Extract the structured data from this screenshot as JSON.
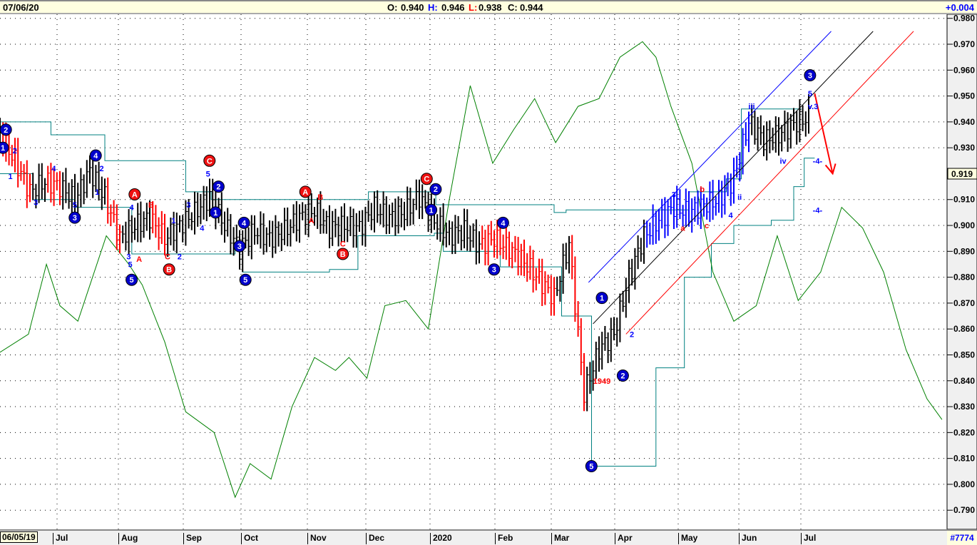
{
  "header": {
    "date": "07/06/20",
    "open_label": "O:",
    "open": "0.940",
    "high_label": "H:",
    "high": "0.946",
    "low_label": "L:",
    "low": "0.938",
    "close_label": "C:",
    "close": "0.944",
    "change": "+0.004"
  },
  "footer": {
    "start_date": "06/05/19",
    "months": [
      "Jul",
      "Aug",
      "Sep",
      "Oct",
      "Nov",
      "Dec",
      "2020",
      "Feb",
      "Mar",
      "Apr",
      "May",
      "Jun",
      "Jul"
    ],
    "record_count": "#7774"
  },
  "colors": {
    "up": "#000000",
    "down": "#ff0000",
    "blue": "#0000ff",
    "osc": "#008000",
    "band": "#008080",
    "axis_bg": "#f0f0f0"
  },
  "chart_data": {
    "type": "bar",
    "title": "",
    "ylim": [
      0.785,
      0.981
    ],
    "yticks": [
      "0.980",
      "0.970",
      "0.960",
      "0.950",
      "0.940",
      "0.930",
      "0.910",
      "0.900",
      "0.890",
      "0.880",
      "0.870",
      "0.860",
      "0.850",
      "0.840",
      "0.830",
      "0.820",
      "0.810",
      "0.800",
      "0.790"
    ],
    "last_price": "0.919",
    "x_unit": "weeks since 06/05/19",
    "weekly_closes": [
      0.935,
      0.925,
      0.913,
      0.917,
      0.915,
      0.91,
      0.921,
      0.911,
      0.895,
      0.9,
      0.903,
      0.895,
      0.9,
      0.905,
      0.911,
      0.9,
      0.891,
      0.898,
      0.895,
      0.898,
      0.903,
      0.906,
      0.899,
      0.9,
      0.899,
      0.907,
      0.903,
      0.905,
      0.911,
      0.902,
      0.896,
      0.898,
      0.892,
      0.895,
      0.891,
      0.886,
      0.879,
      0.872,
      0.893,
      0.835,
      0.852,
      0.858,
      0.88,
      0.896,
      0.902,
      0.907,
      0.905,
      0.908,
      0.91,
      0.918,
      0.94,
      0.933,
      0.935,
      0.939,
      0.942
    ],
    "bar_colors": [
      "k",
      "r",
      "r",
      "k",
      "r",
      "k",
      "k",
      "k",
      "r",
      "k",
      "k",
      "r",
      "k",
      "k",
      "k",
      "k",
      "k",
      "k",
      "k",
      "k",
      "k",
      "k",
      "k",
      "k",
      "k",
      "k",
      "k",
      "k",
      "k",
      "k",
      "k",
      "k",
      "k",
      "r",
      "r",
      "r",
      "r",
      "r",
      "k",
      "r",
      "k",
      "k",
      "k",
      "k",
      "b",
      "b",
      "b",
      "b",
      "b",
      "b",
      "b",
      "k",
      "k",
      "k",
      "k"
    ],
    "oscillator": [
      [
        0,
        0.851
      ],
      [
        1.9,
        0.858
      ],
      [
        3.1,
        0.885
      ],
      [
        4,
        0.869
      ],
      [
        5.2,
        0.863
      ],
      [
        7.1,
        0.896
      ],
      [
        8.6,
        0.885
      ],
      [
        9.5,
        0.877
      ],
      [
        11,
        0.855
      ],
      [
        12.4,
        0.828
      ],
      [
        14.3,
        0.82
      ],
      [
        15.7,
        0.795
      ],
      [
        16.7,
        0.808
      ],
      [
        18.1,
        0.802
      ],
      [
        19.5,
        0.83
      ],
      [
        21,
        0.849
      ],
      [
        22.4,
        0.844
      ],
      [
        23.3,
        0.849
      ],
      [
        24.5,
        0.841
      ],
      [
        25.7,
        0.869
      ],
      [
        27.1,
        0.871
      ],
      [
        28.6,
        0.86
      ],
      [
        30,
        0.91
      ],
      [
        31.4,
        0.954
      ],
      [
        32.9,
        0.924
      ],
      [
        34.3,
        0.937
      ],
      [
        35.7,
        0.949
      ],
      [
        37.1,
        0.932
      ],
      [
        38.6,
        0.946
      ],
      [
        40,
        0.949
      ],
      [
        41.4,
        0.965
      ],
      [
        42.9,
        0.971
      ],
      [
        43.8,
        0.965
      ],
      [
        44.8,
        0.946
      ],
      [
        46.2,
        0.924
      ],
      [
        47.6,
        0.882
      ],
      [
        49,
        0.863
      ],
      [
        50.5,
        0.869
      ],
      [
        51.9,
        0.896
      ],
      [
        53.3,
        0.871
      ],
      [
        54.8,
        0.882
      ],
      [
        56.2,
        0.907
      ],
      [
        57.6,
        0.899
      ],
      [
        59,
        0.882
      ],
      [
        60.5,
        0.852
      ],
      [
        61.9,
        0.833
      ],
      [
        62.9,
        0.825
      ]
    ],
    "upper_band": [
      [
        0,
        0.94
      ],
      [
        3.3,
        0.94
      ],
      [
        3.4,
        0.935
      ],
      [
        7,
        0.925
      ],
      [
        10.8,
        0.925
      ],
      [
        12.4,
        0.913
      ],
      [
        14,
        0.913
      ],
      [
        14.1,
        0.91
      ],
      [
        24.5,
        0.91
      ],
      [
        24.6,
        0.913
      ],
      [
        29,
        0.913
      ],
      [
        29.1,
        0.908
      ],
      [
        33.3,
        0.908
      ],
      [
        37,
        0.905
      ],
      [
        37.7,
        0.905
      ],
      [
        37.8,
        0.906
      ],
      [
        42,
        0.906
      ],
      [
        46,
        0.913
      ],
      [
        48.5,
        0.918
      ],
      [
        49.5,
        0.945
      ],
      [
        53.5,
        0.945
      ]
    ],
    "lower_band": [
      [
        0,
        0.92
      ],
      [
        2.2,
        0.91
      ],
      [
        5,
        0.907
      ],
      [
        7.8,
        0.907
      ],
      [
        8.8,
        0.889
      ],
      [
        15.7,
        0.891
      ],
      [
        16.2,
        0.882
      ],
      [
        22,
        0.883
      ],
      [
        23.9,
        0.896
      ],
      [
        29,
        0.897
      ],
      [
        29.6,
        0.89
      ],
      [
        33,
        0.89
      ],
      [
        33.4,
        0.884
      ],
      [
        36.7,
        0.884
      ],
      [
        37.5,
        0.865
      ],
      [
        39.5,
        0.807
      ],
      [
        42.8,
        0.807
      ],
      [
        43.8,
        0.845
      ],
      [
        45.7,
        0.88
      ],
      [
        47.5,
        0.893
      ],
      [
        49,
        0.9
      ],
      [
        51.5,
        0.902
      ],
      [
        53,
        0.915
      ],
      [
        53.7,
        0.926
      ],
      [
        54.4,
        0.926
      ]
    ],
    "trendlines": [
      {
        "color": "blue",
        "from": [
          39.3,
          0.878
        ],
        "to": [
          55.5,
          0.975
        ]
      },
      {
        "color": "black",
        "from": [
          39.6,
          0.862
        ],
        "to": [
          58.3,
          0.975
        ]
      },
      {
        "color": "red",
        "from": [
          41.8,
          0.858
        ],
        "to": [
          61,
          0.975
        ]
      },
      {
        "color": "red",
        "from": [
          54.4,
          0.951
        ],
        "to": [
          55.6,
          0.92
        ],
        "arrow": true
      }
    ],
    "annotations": [
      {
        "text": "2",
        "w": 0.2,
        "p": 0.937,
        "style": "circle-blue"
      },
      {
        "text": "1",
        "w": 0,
        "p": 0.93,
        "style": "circle-blue"
      },
      {
        "text": "2",
        "w": 0.8,
        "p": 0.929,
        "style": "blue"
      },
      {
        "text": "1",
        "w": 0.5,
        "p": 0.919,
        "style": "blue"
      },
      {
        "text": "3",
        "w": 2.2,
        "p": 0.909,
        "style": "blue"
      },
      {
        "text": "4",
        "w": 3.4,
        "p": 0.922,
        "style": "blue"
      },
      {
        "text": "5",
        "w": 4.8,
        "p": 0.908,
        "style": "blue"
      },
      {
        "text": "3",
        "w": 4.8,
        "p": 0.903,
        "style": "circle-blue"
      },
      {
        "text": "4",
        "w": 6.2,
        "p": 0.927,
        "style": "circle-blue"
      },
      {
        "text": "2",
        "w": 6.6,
        "p": 0.922,
        "style": "blue"
      },
      {
        "text": "1",
        "w": 6.3,
        "p": 0.913,
        "style": "blue"
      },
      {
        "text": "A",
        "w": 8.8,
        "p": 0.912,
        "style": "circle-red"
      },
      {
        "text": "4",
        "w": 8.6,
        "p": 0.907,
        "style": "blue"
      },
      {
        "text": "B",
        "w": 9.9,
        "p": 0.908,
        "style": "red"
      },
      {
        "text": "3",
        "w": 8.4,
        "p": 0.888,
        "style": "blue"
      },
      {
        "text": "A",
        "w": 9.1,
        "p": 0.887,
        "style": "red"
      },
      {
        "text": "5",
        "w": 8.5,
        "p": 0.885,
        "style": "blue"
      },
      {
        "text": "5",
        "w": 8.6,
        "p": 0.879,
        "style": "circle-blue"
      },
      {
        "text": "1",
        "w": 11.4,
        "p": 0.902,
        "style": "blue"
      },
      {
        "text": "C",
        "w": 11.0,
        "p": 0.888,
        "style": "red"
      },
      {
        "text": "2",
        "w": 11.8,
        "p": 0.888,
        "style": "blue"
      },
      {
        "text": "B",
        "w": 11.1,
        "p": 0.883,
        "style": "circle-red"
      },
      {
        "text": "3",
        "w": 12.4,
        "p": 0.908,
        "style": "blue"
      },
      {
        "text": "4",
        "w": 13.3,
        "p": 0.899,
        "style": "blue"
      },
      {
        "text": "C",
        "w": 13.8,
        "p": 0.925,
        "style": "circle-red"
      },
      {
        "text": "5",
        "w": 13.7,
        "p": 0.92,
        "style": "blue"
      },
      {
        "text": "2",
        "w": 14.4,
        "p": 0.915,
        "style": "circle-blue"
      },
      {
        "text": "1",
        "w": 14.2,
        "p": 0.905,
        "style": "circle-blue"
      },
      {
        "text": "4",
        "w": 16.1,
        "p": 0.901,
        "style": "circle-blue"
      },
      {
        "text": "3",
        "w": 15.8,
        "p": 0.892,
        "style": "circle-blue"
      },
      {
        "text": "5",
        "w": 16.2,
        "p": 0.879,
        "style": "circle-blue"
      },
      {
        "text": "A",
        "w": 20.2,
        "p": 0.913,
        "style": "circle-red"
      },
      {
        "text": "B",
        "w": 21.2,
        "p": 0.911,
        "style": "red"
      },
      {
        "text": "A",
        "w": 20.6,
        "p": 0.902,
        "style": "red"
      },
      {
        "text": "C",
        "w": 22.7,
        "p": 0.893,
        "style": "red"
      },
      {
        "text": "B",
        "w": 22.7,
        "p": 0.889,
        "style": "circle-red"
      },
      {
        "text": "C",
        "w": 28.3,
        "p": 0.918,
        "style": "circle-red"
      },
      {
        "text": "2",
        "w": 28.9,
        "p": 0.914,
        "style": "circle-blue"
      },
      {
        "text": "1",
        "w": 28.6,
        "p": 0.906,
        "style": "circle-blue"
      },
      {
        "text": "4",
        "w": 33.4,
        "p": 0.901,
        "style": "circle-blue"
      },
      {
        "text": "3",
        "w": 32.8,
        "p": 0.883,
        "style": "circle-blue"
      },
      {
        "text": "1",
        "w": 40.0,
        "p": 0.872,
        "style": "circle-blue"
      },
      {
        "text": "1949",
        "w": 40.0,
        "p": 0.84,
        "style": "red"
      },
      {
        "text": "2",
        "w": 41.4,
        "p": 0.842,
        "style": "circle-blue"
      },
      {
        "text": "2",
        "w": 42.0,
        "p": 0.858,
        "style": "blue"
      },
      {
        "text": "5",
        "w": 39.3,
        "p": 0.807,
        "style": "circle-blue"
      },
      {
        "text": "3",
        "w": 44.8,
        "p": 0.912,
        "style": "blue"
      },
      {
        "text": "a",
        "w": 45.4,
        "p": 0.899,
        "style": "red"
      },
      {
        "text": "b",
        "w": 46.7,
        "p": 0.914,
        "style": "red"
      },
      {
        "text": "c",
        "w": 47.0,
        "p": 0.9,
        "style": "red"
      },
      {
        "text": "4",
        "w": 48.6,
        "p": 0.904,
        "style": "blue"
      },
      {
        "text": "i",
        "w": 49.2,
        "p": 0.918,
        "style": "blue"
      },
      {
        "text": "ii",
        "w": 49.2,
        "p": 0.911,
        "style": "blue"
      },
      {
        "text": "iii",
        "w": 50.0,
        "p": 0.946,
        "style": "blue"
      },
      {
        "text": "iv",
        "w": 52.1,
        "p": 0.925,
        "style": "blue"
      },
      {
        "text": "3",
        "w": 53.9,
        "p": 0.958,
        "style": "circle-blue"
      },
      {
        "text": "5",
        "w": 53.9,
        "p": 0.951,
        "style": "blue"
      },
      {
        "text": "v.3",
        "w": 54.1,
        "p": 0.946,
        "style": "blue"
      },
      {
        "text": "-4-",
        "w": 54.4,
        "p": 0.925,
        "style": "blue"
      },
      {
        "text": "-4-",
        "w": 54.4,
        "p": 0.906,
        "style": "blue"
      }
    ]
  }
}
